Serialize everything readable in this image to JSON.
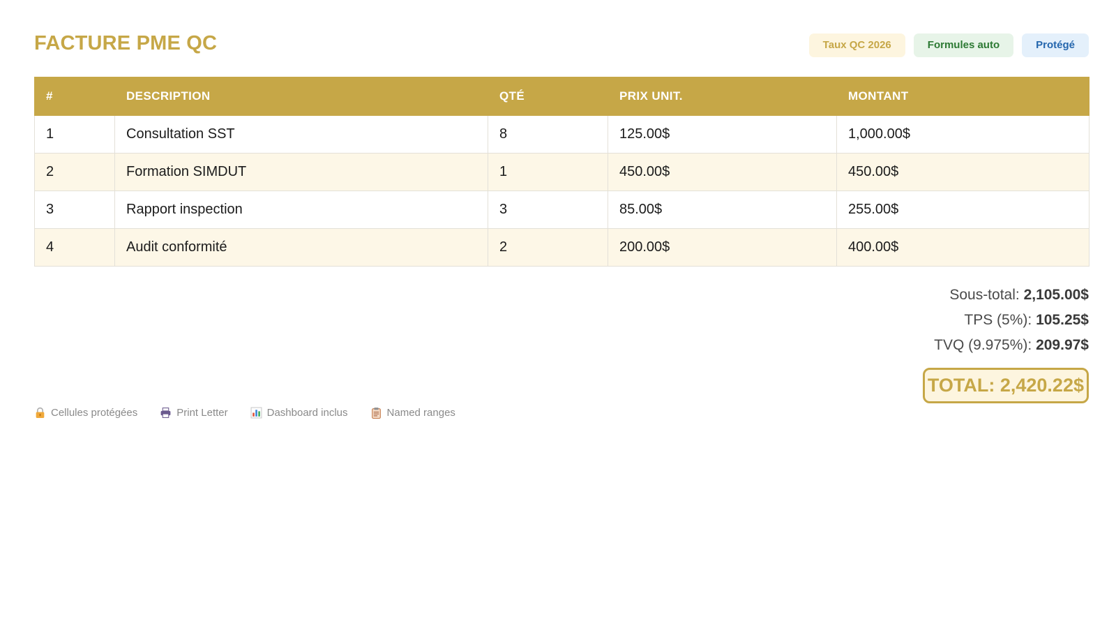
{
  "header": {
    "title": "FACTURE PME QC",
    "badges": [
      {
        "label": "Taux QC 2026"
      },
      {
        "label": "Formules auto"
      },
      {
        "label": "Protégé"
      }
    ]
  },
  "table": {
    "columns": [
      "#",
      "DESCRIPTION",
      "QTÉ",
      "PRIX UNIT.",
      "MONTANT"
    ],
    "rows": [
      [
        "1",
        "Consultation SST",
        "8",
        "125.00$",
        "1,000.00$"
      ],
      [
        "2",
        "Formation SIMDUT",
        "1",
        "450.00$",
        "450.00$"
      ],
      [
        "3",
        "Rapport inspection",
        "3",
        "85.00$",
        "255.00$"
      ],
      [
        "4",
        "Audit conformité",
        "2",
        "200.00$",
        "400.00$"
      ]
    ]
  },
  "totals": {
    "subtotal_label": "Sous-total:",
    "subtotal_value": "2,105.00$",
    "tps_label": "TPS (5%):",
    "tps_value": "105.25$",
    "tvq_label": "TVQ (9.975%):",
    "tvq_value": "209.97$",
    "total": "TOTAL: 2,420.22$"
  },
  "footer": {
    "items": [
      {
        "icon": "lock-icon",
        "label": "Cellules protégées"
      },
      {
        "icon": "printer-icon",
        "label": "Print Letter"
      },
      {
        "icon": "bar-chart-icon",
        "label": "Dashboard inclus"
      },
      {
        "icon": "clipboard-icon",
        "label": "Named ranges"
      }
    ]
  },
  "colors": {
    "accent": "#c6a747",
    "row_alt": "#fdf7e7",
    "badge_green": "#2d7a34",
    "badge_blue": "#2466ad"
  }
}
